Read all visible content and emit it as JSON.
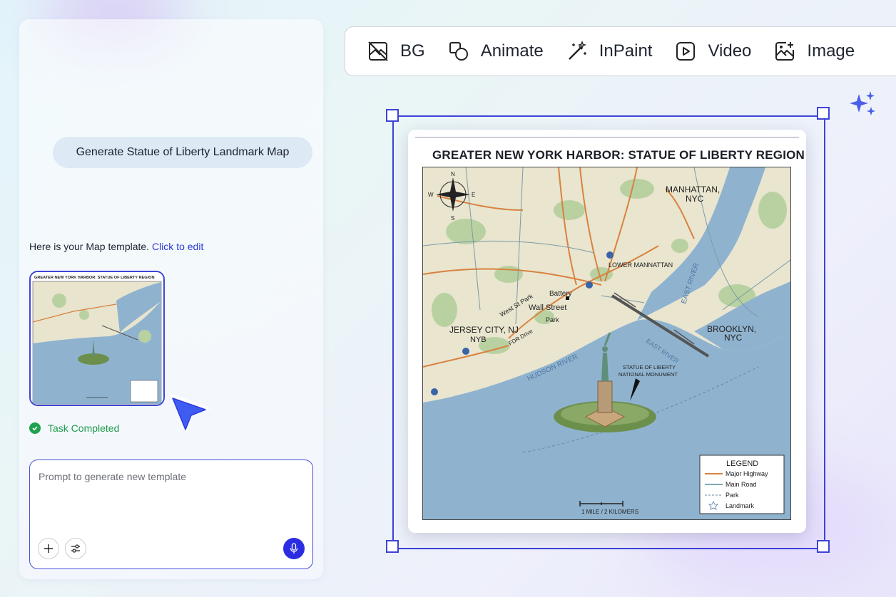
{
  "chat": {
    "user_message": "Generate Statue of Liberty Landmark Map",
    "reply_text": "Here is your Map template.",
    "reply_link": "Click to edit",
    "status": "Task Completed",
    "prompt_placeholder": "Prompt to generate new template"
  },
  "toolbar": {
    "items": [
      {
        "label": "BG",
        "icon": "image-off-icon"
      },
      {
        "label": "Animate",
        "icon": "shapes-icon"
      },
      {
        "label": "InPaint",
        "icon": "magic-wand-icon"
      },
      {
        "label": "Video",
        "icon": "play-icon"
      },
      {
        "label": "Image",
        "icon": "image-add-icon"
      }
    ]
  },
  "map": {
    "title": "GREATER NEW YORK HARBOR: STATUE OF LIBERTY REGION",
    "labels": {
      "manhattan_1": "MANHATTAN,",
      "manhattan_2": "NYC",
      "lower_manhattan": "LOWER MANNATTAN",
      "battery": "Battery",
      "wall_street": "Wall Street",
      "park": "Park",
      "jersey_1": "JERSEY CITY, NJ",
      "jersey_2": "NYB",
      "brooklyn_1": "BROOKLYN,",
      "brooklyn_2": "NYC",
      "statue_1": "STATUE OF LIBERTY",
      "statue_2": "NATIONAL MONUMENT",
      "hudson": "HUDSON RIVER",
      "east_river_1": "EAST RIVER",
      "east_river_2": "EAST RIVER",
      "fdr": "FDR Drive",
      "west_st": "West St Park",
      "compass_n": "N",
      "compass_s": "S",
      "compass_e": "E",
      "compass_w": "W",
      "scale": "1 MILE / 2 KILOMERS"
    },
    "legend": {
      "title": "LEGEND",
      "items": [
        "Major Highway",
        "Main Road",
        "Park",
        "Landmark"
      ]
    },
    "thumb_title": "GREATER NEW YORK HARBOR: STATUE OF LIBERTY REGION"
  },
  "colors": {
    "accent": "#3d43d8",
    "water": "#8fb3cf",
    "land": "#e9e5cf",
    "park": "#b9d1a1",
    "highway": "#d9823f",
    "success": "#1fa14d"
  }
}
